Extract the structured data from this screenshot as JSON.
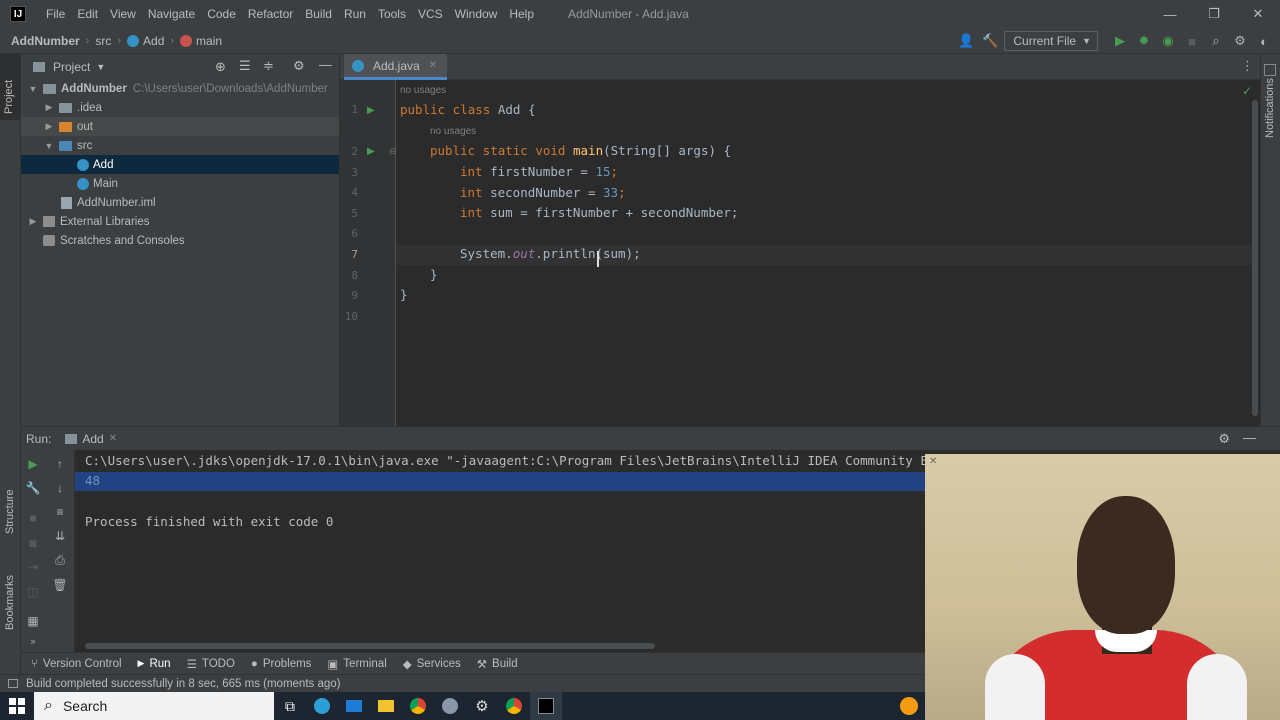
{
  "menubar": {
    "logo": "IJ",
    "items": [
      "File",
      "Edit",
      "View",
      "Navigate",
      "Code",
      "Refactor",
      "Build",
      "Run",
      "Tools",
      "VCS",
      "Window",
      "Help"
    ],
    "window_title": "AddNumber - Add.java",
    "controls": {
      "minimize": "—",
      "restore": "❐",
      "close": "✕"
    }
  },
  "navbar": {
    "project": "AddNumber",
    "folder": "src",
    "file": "Add",
    "method": "main",
    "run_config": "Current File"
  },
  "left_stripe": {
    "project_label": "Project",
    "structure_label": "Structure",
    "bookmarks_label": "Bookmarks"
  },
  "right_stripe": {
    "notifications_label": "Notifications"
  },
  "project_panel": {
    "title": "Project",
    "root_name": "AddNumber",
    "root_path": "C:\\Users\\user\\Downloads\\AddNumber",
    "items": [
      ".idea",
      "out",
      "src",
      "Add",
      "Main",
      "AddNumber.iml",
      "External Libraries",
      "Scratches and Consoles"
    ]
  },
  "editor": {
    "tab_label": "Add.java",
    "usage_hint_1": "no usages",
    "usage_hint_2": "no usages",
    "line_numbers": [
      "1",
      "2",
      "3",
      "4",
      "5",
      "6",
      "7",
      "8",
      "9",
      "10"
    ],
    "code": {
      "l1_kw": "public class ",
      "l1_rest": "Add {",
      "l2_kw": "public static void ",
      "l2_fn": "main",
      "l2_rest": "(String[] args) {",
      "l3_kw": "int ",
      "l3_rest": "firstNumber = ",
      "l3_num": "15",
      "l3_end": ";",
      "l4_kw": "int ",
      "l4_rest": "secondNumber = ",
      "l4_num": "33",
      "l4_end": ";",
      "l5_kw": "int ",
      "l5_rest": "sum = firstNumber + secondNumber;",
      "l7_a": "System.",
      "l7_out": "out",
      "l7_b": ".println(sum);",
      "l8": "}",
      "l9": "}"
    }
  },
  "run_panel": {
    "title": "Run:",
    "tab_label": "Add",
    "console": {
      "command": "C:\\Users\\user\\.jdks\\openjdk-17.0.1\\bin\\java.exe \"-javaagent:C:\\Program Files\\JetBrains\\IntelliJ IDEA Community E",
      "output": "48",
      "finished": "Process finished with exit code 0"
    }
  },
  "tool_windows": [
    "Version Control",
    "Run",
    "TODO",
    "Problems",
    "Terminal",
    "Services",
    "Build"
  ],
  "status_bar": {
    "message": "Build completed successfully in 8 sec, 665 ms (moments ago)"
  },
  "taskbar": {
    "search_placeholder": "Search"
  }
}
